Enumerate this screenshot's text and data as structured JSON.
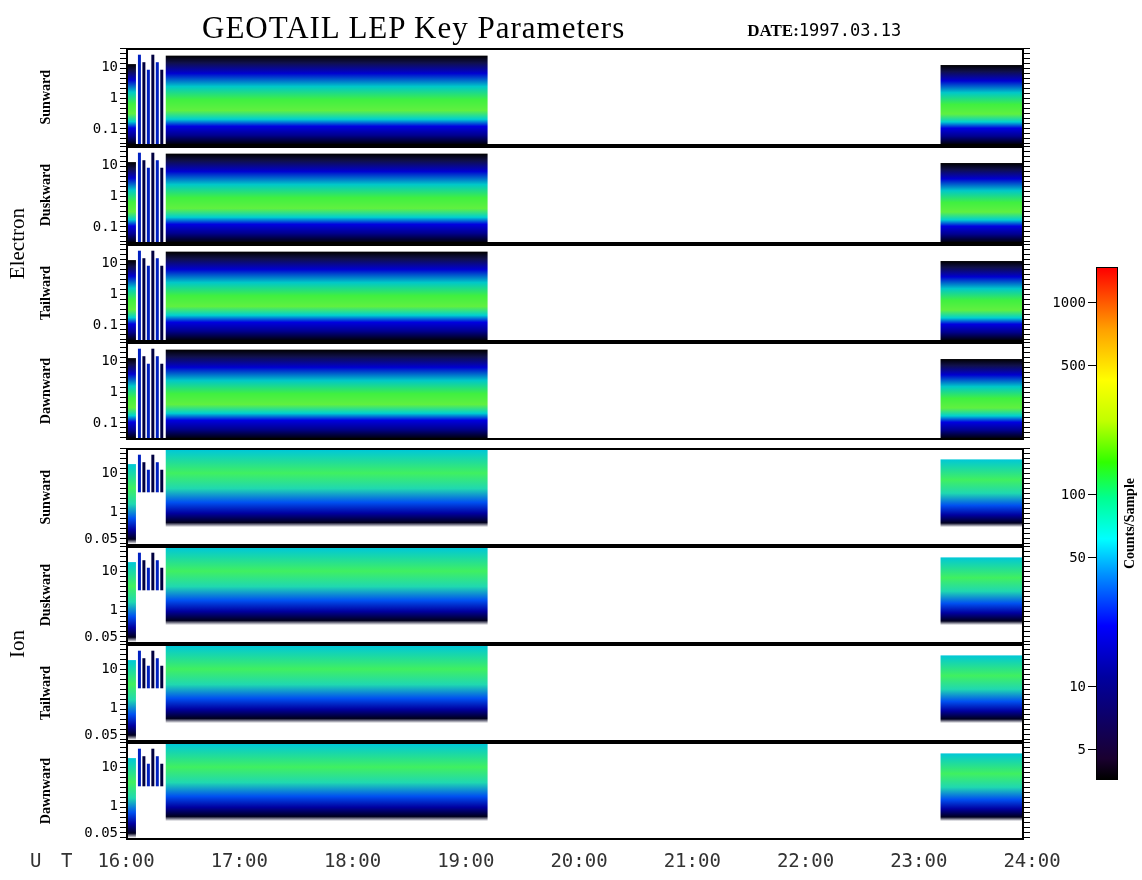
{
  "title": "GEOTAIL LEP Key Parameters",
  "date": {
    "label": "DATE:",
    "value": "1997.03.13"
  },
  "groups": [
    {
      "name": "Electron",
      "kind": "electron",
      "panels": [
        {
          "label": "Sunward",
          "y_ticks": [
            "10",
            "1",
            "0.1"
          ]
        },
        {
          "label": "Duskward",
          "y_ticks": [
            "10",
            "1",
            "0.1"
          ]
        },
        {
          "label": "Tailward",
          "y_ticks": [
            "10",
            "1",
            "0.1"
          ]
        },
        {
          "label": "Dawnward",
          "y_ticks": [
            "10",
            "1",
            "0.1"
          ]
        }
      ]
    },
    {
      "name": "Ion",
      "kind": "ion",
      "panels": [
        {
          "label": "Sunward",
          "y_ticks": [
            "10",
            "1",
            "0.05"
          ]
        },
        {
          "label": "Duskward",
          "y_ticks": [
            "10",
            "1",
            "0.05"
          ]
        },
        {
          "label": "Tailward",
          "y_ticks": [
            "10",
            "1",
            "0.05"
          ]
        },
        {
          "label": "Dawnward",
          "y_ticks": [
            "10",
            "1",
            "0.05"
          ]
        }
      ]
    }
  ],
  "time_axis": {
    "label": "U T",
    "ticks": [
      "16:00",
      "17:00",
      "18:00",
      "19:00",
      "20:00",
      "21:00",
      "22:00",
      "23:00",
      "24:00"
    ]
  },
  "colorbar": {
    "title": "Counts/Sample",
    "ticks": [
      "1000",
      "500",
      "100",
      "50",
      "10",
      "5"
    ]
  }
}
